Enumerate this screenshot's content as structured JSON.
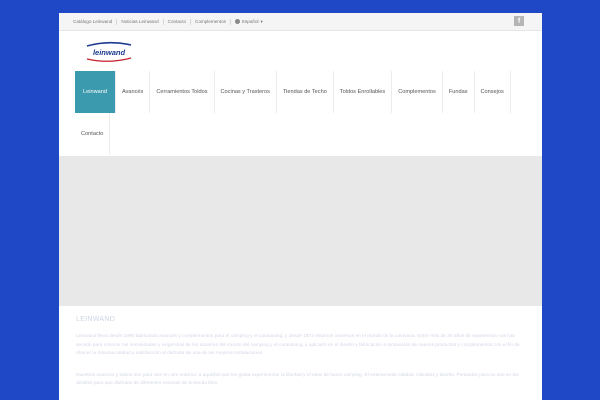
{
  "topbar": {
    "links": [
      "Catálogo Leinwand",
      "Noticias Leinwand",
      "Contacto",
      "Complementos"
    ],
    "language": "Español",
    "facebook_glyph": "f"
  },
  "logo": {
    "text": "leinwand"
  },
  "nav": {
    "items": [
      "Leinwand",
      "Avancés",
      "Cerramientos Toldos",
      "Cocinas y Trasteros",
      "Tiendas de Techo",
      "Toldos Enrollables",
      "Complementos",
      "Fundas",
      "Consejos"
    ],
    "items_row2": [
      "Contacto"
    ],
    "active_index": 0
  },
  "content": {
    "title": "LEINWAND",
    "paragraph1": "Leinwand lleva desde 1995 fabricando avancés y complementos para el camping y el caravaning, y desde 1973 estamos inmersos en el mundo de la caravana. Entre más de 30 años de experiencia nos han servido para conocer las necesidades y exigencias de los usuarios del mundo del camping y el caravaning, y aplicarlo en el diseño y fabricación e innovación de nuevos productos y complementos con el fin de ofrecer la máxima calidad y satisfacción al disfrutar de una de las mejores instalaciones.",
    "paragraph2": "Nuestros avances y toldos son para vivir en otro entorno: a aquellos que les gusta experimentar la libertad y el relax de hacer camping. El enteramente calidad, robustez y diseño. Pensados para un uso en los detalles para que disfrutes de diferentes escenas de tu tienda libre."
  },
  "colors": {
    "background": "#1f48c6",
    "accent": "#3b9aad",
    "hero": "#e8e8e8"
  }
}
